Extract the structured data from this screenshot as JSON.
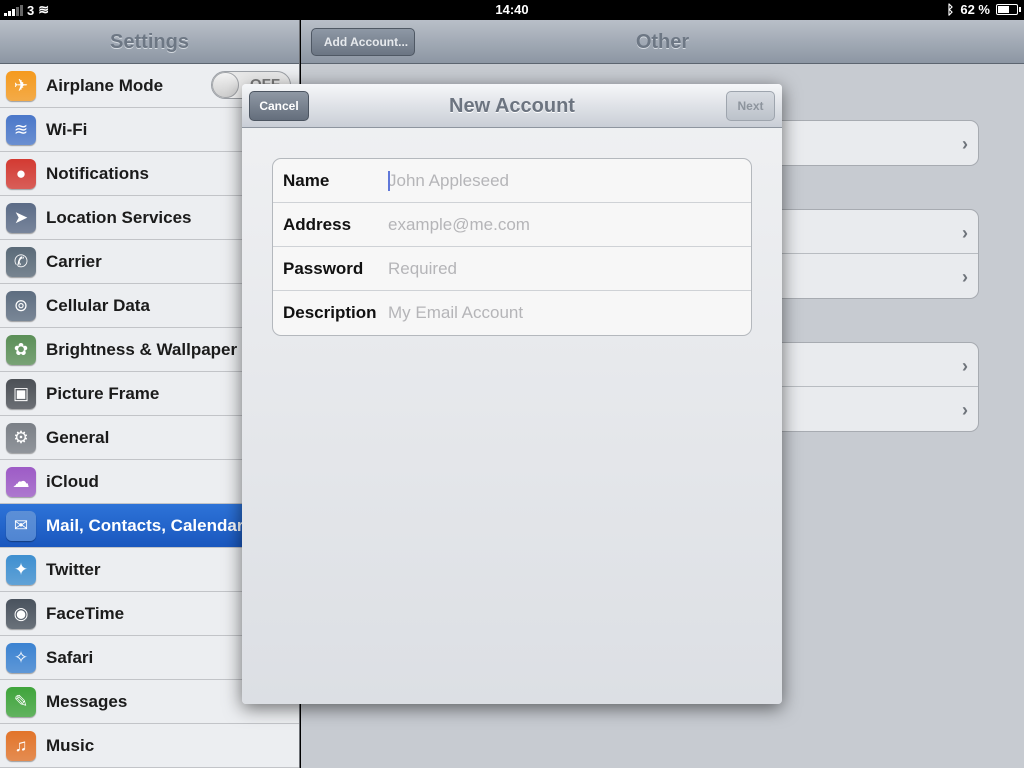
{
  "status_bar": {
    "carrier": "3",
    "time": "14:40",
    "battery_percent": "62 %",
    "battery_level": 0.62
  },
  "sidebar": {
    "title": "Settings",
    "items": [
      {
        "label": "Airplane Mode",
        "icon": "airplane-icon",
        "color": "#f59a1e",
        "glyph": "✈",
        "toggle": "OFF"
      },
      {
        "label": "Wi-Fi",
        "icon": "wifi-icon",
        "color": "#4a77c9",
        "glyph": "≋"
      },
      {
        "label": "Notifications",
        "icon": "notifications-icon",
        "color": "#d33a32",
        "glyph": "●"
      },
      {
        "label": "Location Services",
        "icon": "location-arrow-icon",
        "color": "#5b6b86",
        "glyph": "➤"
      },
      {
        "label": "Carrier",
        "icon": "phone-icon",
        "color": "#5a6a78",
        "glyph": "✆"
      },
      {
        "label": "Cellular Data",
        "icon": "cellular-antenna-icon",
        "color": "#5d6d80",
        "glyph": "⊚"
      },
      {
        "label": "Brightness & Wallpaper",
        "icon": "flower-icon",
        "color": "#5b8f57",
        "glyph": "✿"
      },
      {
        "label": "Picture Frame",
        "icon": "picture-frame-icon",
        "color": "#4b4f55",
        "glyph": "▣"
      },
      {
        "label": "General",
        "icon": "gear-icon",
        "color": "#7a7f86",
        "glyph": "⚙"
      },
      {
        "label": "iCloud",
        "icon": "cloud-icon",
        "color": "#9d5bc6",
        "glyph": "☁"
      },
      {
        "label": "Mail, Contacts, Calendars",
        "icon": "mail-icon",
        "color": "#5c8fd6",
        "glyph": "✉",
        "selected": true
      },
      {
        "label": "Twitter",
        "icon": "twitter-bird-icon",
        "color": "#3e8fd0",
        "glyph": "✦"
      },
      {
        "label": "FaceTime",
        "icon": "facetime-camera-icon",
        "color": "#49525d",
        "glyph": "◉"
      },
      {
        "label": "Safari",
        "icon": "safari-compass-icon",
        "color": "#3b82d1",
        "glyph": "✧"
      },
      {
        "label": "Messages",
        "icon": "messages-bubble-icon",
        "color": "#3fa43b",
        "glyph": "✎"
      },
      {
        "label": "Music",
        "icon": "music-note-icon",
        "color": "#e2742a",
        "glyph": "♫"
      }
    ]
  },
  "detail": {
    "back_label": "Add Account...",
    "title": "Other"
  },
  "modal": {
    "title": "New Account",
    "cancel_label": "Cancel",
    "next_label": "Next",
    "fields": [
      {
        "label": "Name",
        "placeholder": "John Appleseed",
        "value": "",
        "type": "text"
      },
      {
        "label": "Address",
        "placeholder": "example@me.com",
        "value": "",
        "type": "email"
      },
      {
        "label": "Password",
        "placeholder": "Required",
        "value": "",
        "type": "password"
      },
      {
        "label": "Description",
        "placeholder": "My Email Account",
        "value": "",
        "type": "text"
      }
    ]
  }
}
